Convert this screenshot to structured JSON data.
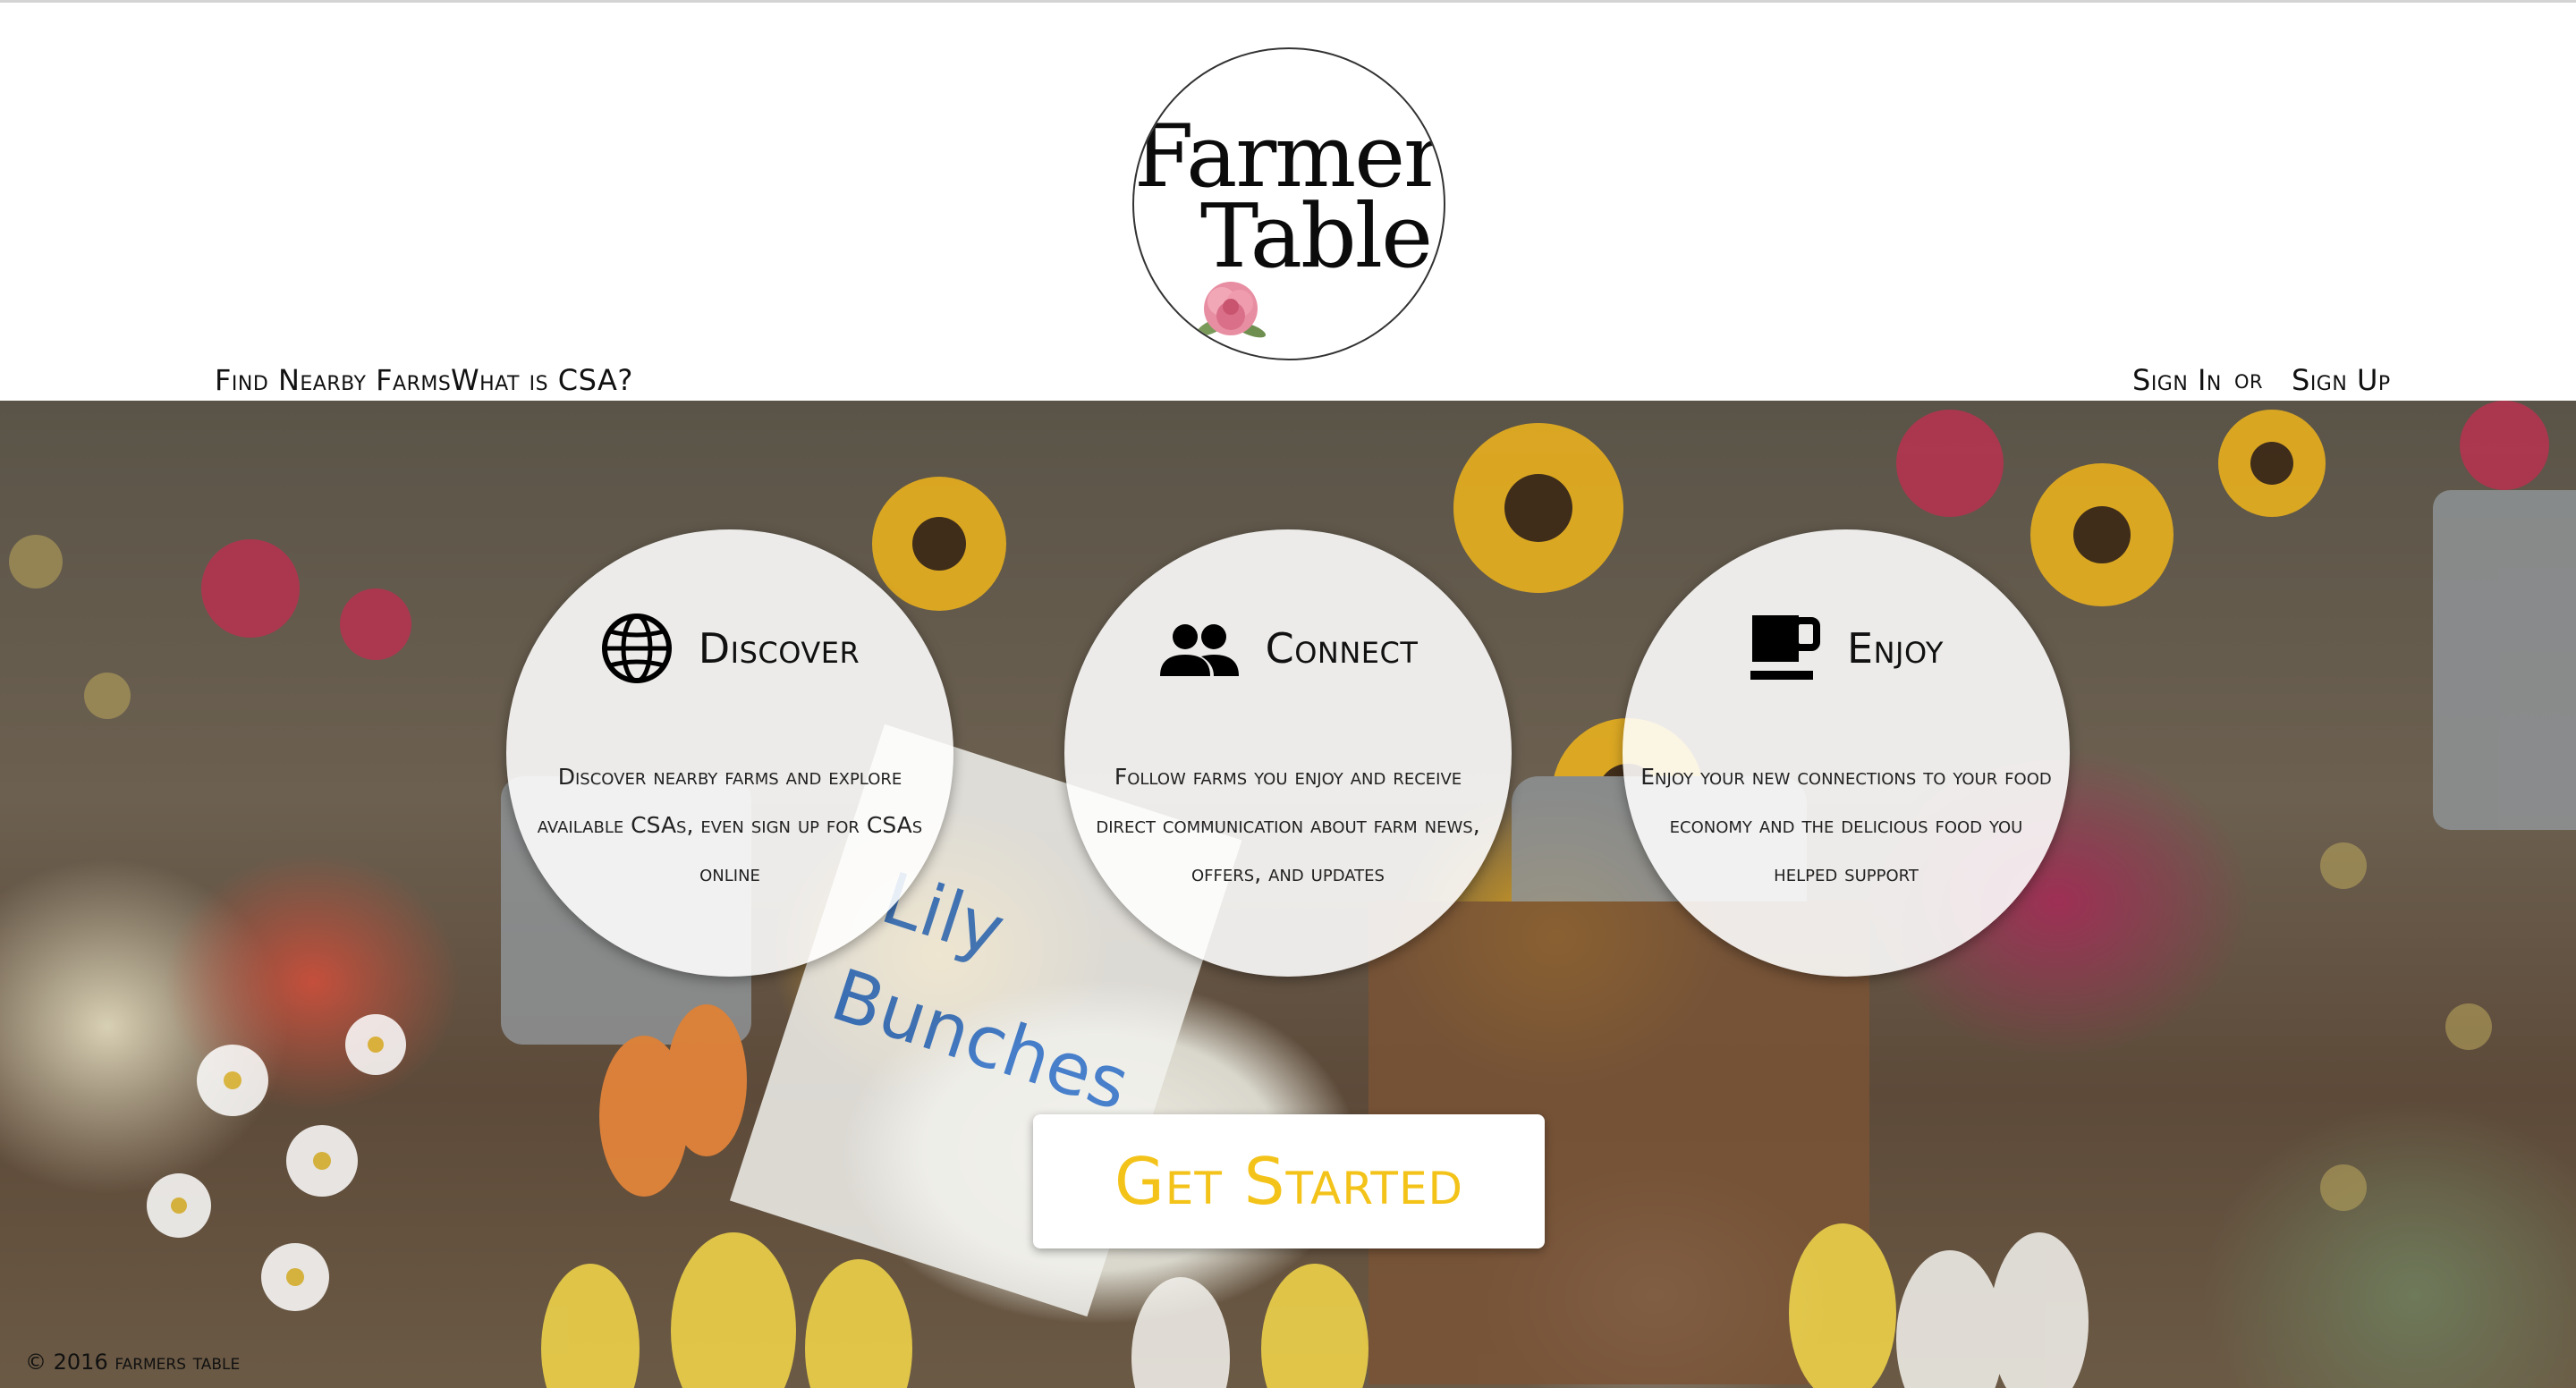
{
  "brand": {
    "line1": "Farmer’s",
    "line2": "Table"
  },
  "nav": {
    "find_farms": "Find Nearby Farms",
    "what_is_csa": "What is CSA?",
    "sign_in": "Sign In",
    "or": "or",
    "sign_up": "Sign Up"
  },
  "features": [
    {
      "icon": "globe-icon",
      "title": "Discover",
      "text": "Discover nearby farms and explore available CSAs, even sign up for CSAs online"
    },
    {
      "icon": "people-icon",
      "title": "Connect",
      "text": "Follow farms you enjoy and receive direct communication about farm news, offers, and updates"
    },
    {
      "icon": "coffee-cup-icon",
      "title": "Enjoy",
      "text": "Enjoy your new connections to your food economy and the delicious food you helped support"
    }
  ],
  "cta": {
    "label": "Get Started"
  },
  "footer": {
    "copyright": "© 2016",
    "name": "farmers table"
  },
  "colors": {
    "accent": "#f3c31a",
    "card_bg": "#ffffff",
    "text": "#111111"
  }
}
